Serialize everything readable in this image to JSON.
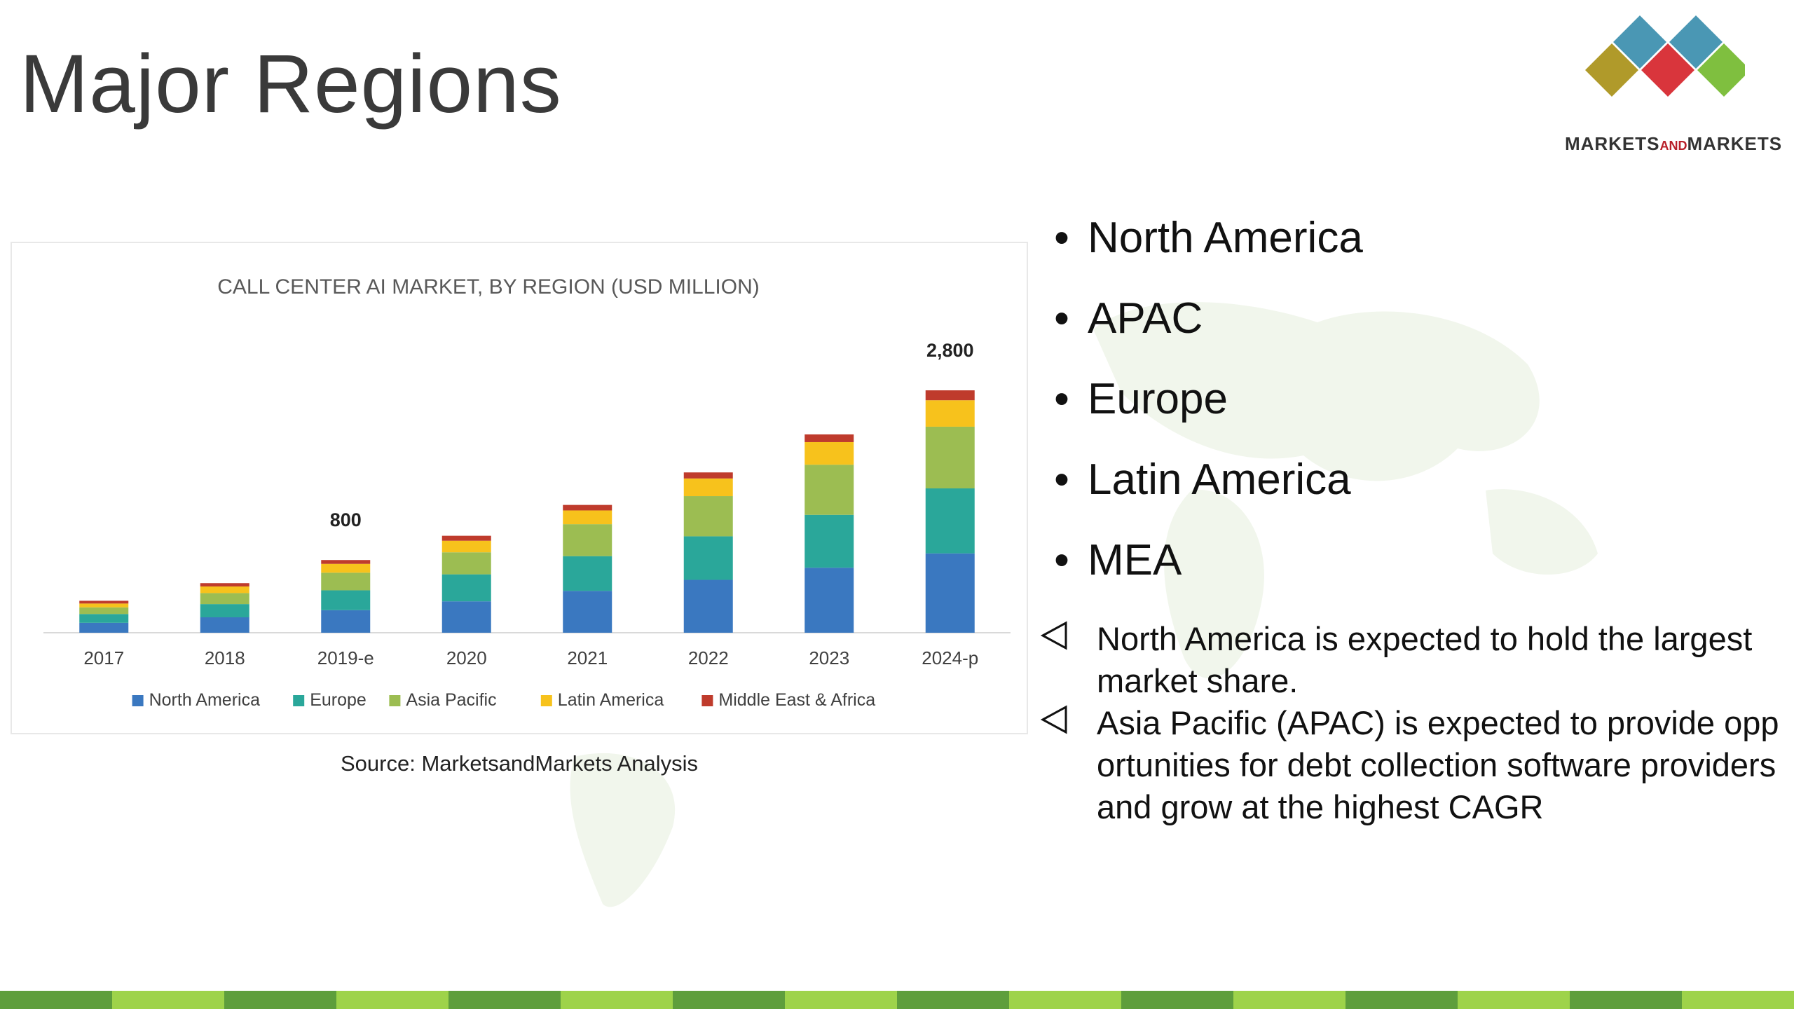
{
  "slide": {
    "title": "Major Regions",
    "logo_text_pre": "MARKETS",
    "logo_text_and": "AND",
    "logo_text_post": "MARKETS",
    "source": "Source: MarketsandMarkets Analysis"
  },
  "bullets": [
    "North America",
    "APAC",
    "Europe",
    "Latin America",
    "MEA"
  ],
  "notes": [
    "North America is expected to hold the largest market share.",
    "Asia Pacific (APAC) is expected to provide opportunities for debt collection software providers and grow at the highest CAGR"
  ],
  "colors": {
    "north_america": "#3a78c0",
    "europe": "#2aa79a",
    "asia_pacific": "#9cbd52",
    "latin_america": "#f7c21c",
    "mea": "#bf3b2c",
    "footer_dark": "#5e9e3c",
    "footer_light": "#9ed34a",
    "logo": [
      "#4a97b4",
      "#4a97b4",
      "#b09a2a",
      "#d9353c",
      "#7fbf3f"
    ]
  },
  "chart_data": {
    "type": "bar",
    "stacked": true,
    "title": "CALL CENTER AI MARKET, BY REGION (USD MILLION)",
    "categories": [
      "2017",
      "2018",
      "2019-e",
      "2020",
      "2021",
      "2022",
      "2023",
      "2024-p"
    ],
    "series": [
      {
        "name": "North America",
        "values": [
          90,
          140,
          205,
          285,
          380,
          480,
          590,
          720
        ]
      },
      {
        "name": "Europe",
        "values": [
          80,
          120,
          180,
          245,
          315,
          395,
          480,
          590
        ]
      },
      {
        "name": "Asia Pacific",
        "values": [
          60,
          100,
          160,
          200,
          290,
          365,
          455,
          560
        ]
      },
      {
        "name": "Latin America",
        "values": [
          35,
          60,
          80,
          105,
          125,
          160,
          205,
          240
        ]
      },
      {
        "name": "Middle East & Africa",
        "values": [
          25,
          30,
          35,
          45,
          50,
          55,
          70,
          90
        ]
      }
    ],
    "data_labels": [
      {
        "category": "2019-e",
        "text": "800"
      },
      {
        "category": "2024-p",
        "text": "2,800"
      }
    ],
    "ylim": [
      0,
      2900
    ],
    "grid": false,
    "legend": "bottom"
  }
}
